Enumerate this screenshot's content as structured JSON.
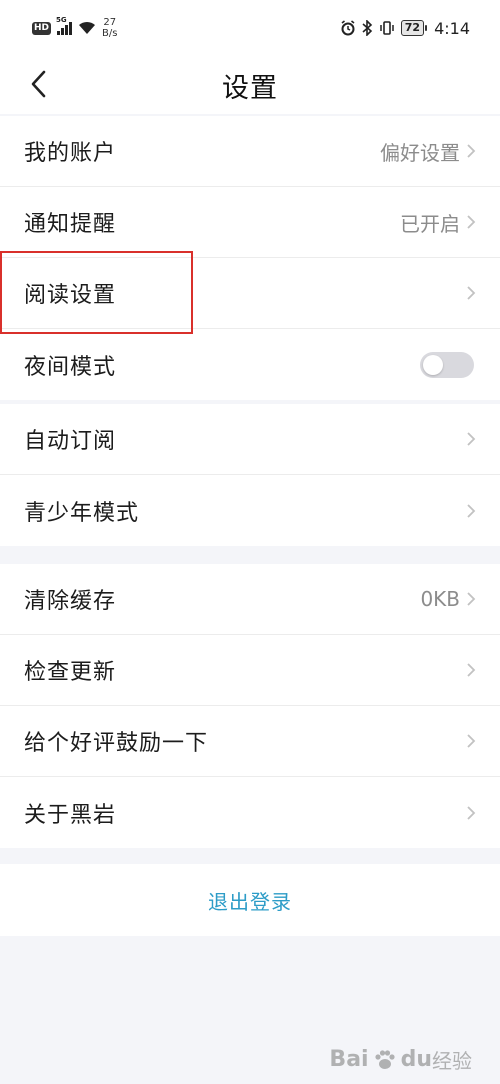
{
  "status_bar": {
    "hd": "HD",
    "signal_type": "5G",
    "net_speed_value": "27",
    "net_speed_unit": "B/s",
    "battery": "72",
    "time": "4:14"
  },
  "header": {
    "title": "设置"
  },
  "groups": [
    {
      "rows": [
        {
          "label": "我的账户",
          "value": "偏好设置",
          "control": "chevron"
        },
        {
          "label": "通知提醒",
          "value": "已开启",
          "control": "chevron"
        },
        {
          "label": "阅读设置",
          "value": "",
          "control": "chevron"
        },
        {
          "label": "夜间模式",
          "value": "",
          "control": "toggle",
          "toggle_on": false
        }
      ]
    },
    {
      "rows": [
        {
          "label": "自动订阅",
          "value": "",
          "control": "chevron"
        },
        {
          "label": "青少年模式",
          "value": "",
          "control": "chevron"
        }
      ]
    },
    {
      "rows": [
        {
          "label": "清除缓存",
          "value": "0KB",
          "control": "chevron"
        },
        {
          "label": "检查更新",
          "value": "",
          "control": "chevron"
        },
        {
          "label": "给个好评鼓励一下",
          "value": "",
          "control": "chevron"
        },
        {
          "label": "关于黑岩",
          "value": "",
          "control": "chevron"
        }
      ]
    }
  ],
  "logout_label": "退出登录",
  "watermark": {
    "left": "Bai",
    "right": "du",
    "sub": "经验"
  },
  "colors": {
    "accent": "#2d9cc7",
    "highlight_box": "#d9302b",
    "background": "#f4f5f9"
  }
}
